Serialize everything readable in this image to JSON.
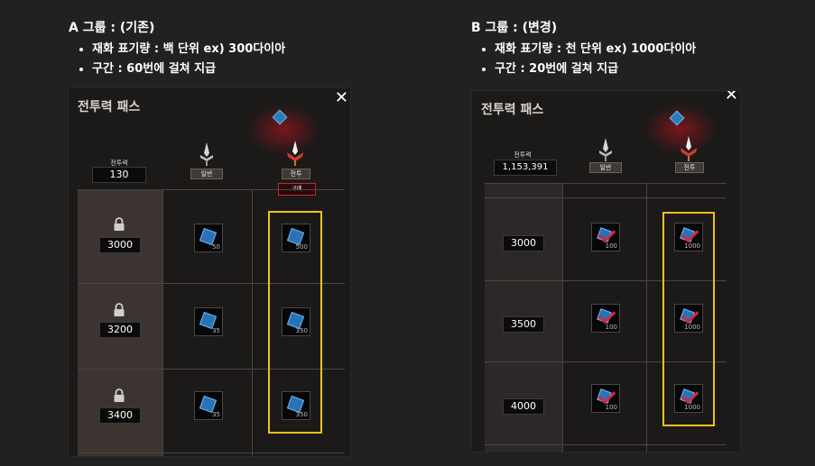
{
  "group_a": {
    "title": "A 그룹 : (기존)",
    "bullets": [
      "재화 표기량 : 백 단위 ex) 300다이아",
      "구간 : 60번에 걸쳐 지급"
    ],
    "panel_title": "전투력 패스",
    "power_label": "전투력",
    "power_value": "130",
    "tier_normal": "일반",
    "tier_battle": "전투",
    "buy_label": "구매",
    "rows": [
      {
        "level": "3000",
        "normal_qty": "50",
        "premium_qty": "500"
      },
      {
        "level": "3200",
        "normal_qty": "35",
        "premium_qty": "350"
      },
      {
        "level": "3400",
        "normal_qty": "35",
        "premium_qty": "350"
      }
    ]
  },
  "group_b": {
    "title": "B 그룹 : (변경)",
    "bullets": [
      "재화 표기량 : 천 단위 ex) 1000다이아",
      "구간 : 20번에 걸쳐 지급"
    ],
    "panel_title": "전투력 패스",
    "power_label": "전투력",
    "power_value": "1,153,391",
    "tier_normal": "일반",
    "tier_battle": "전투",
    "rows": [
      {
        "level": "3000",
        "normal_qty": "100",
        "premium_qty": "1000"
      },
      {
        "level": "3500",
        "normal_qty": "100",
        "premium_qty": "1000"
      },
      {
        "level": "4000",
        "normal_qty": "100",
        "premium_qty": "1000"
      }
    ]
  },
  "icons": {
    "close": "close-icon",
    "lock": "lock-icon",
    "sword": "sword-icon",
    "diamond": "diamond-icon",
    "checkmark": "checkmark-icon"
  },
  "colors": {
    "highlight": "#f2c119",
    "accent_red": "#c22a2a",
    "gem_blue": "#2a72b8"
  }
}
